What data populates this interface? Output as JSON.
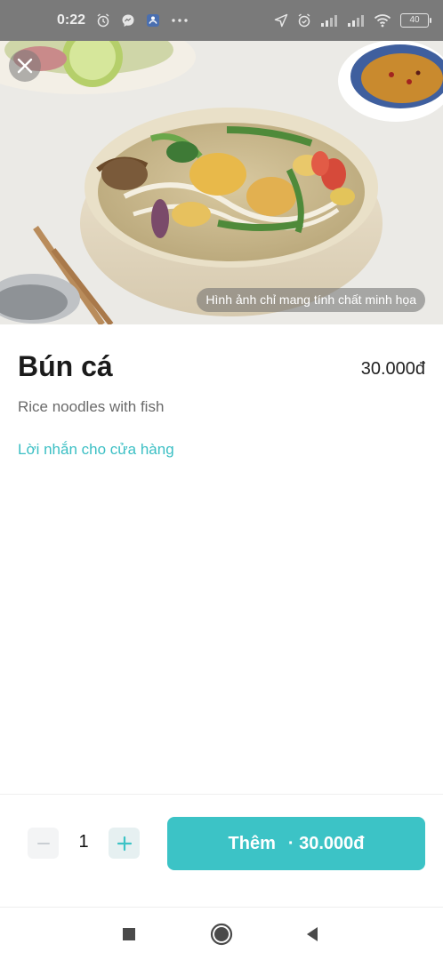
{
  "status_bar": {
    "time": "0:22",
    "battery": "40"
  },
  "hero": {
    "illustration_note": "Hình ảnh chỉ mang tính chất minh họa"
  },
  "product": {
    "name": "Bún cá",
    "price": "30.000đ",
    "description": "Rice noodles with fish",
    "store_note_link": "Lời nhắn cho cửa hàng"
  },
  "cart": {
    "quantity": "1",
    "add_label": "Thêm",
    "add_price": "· 30.000đ"
  },
  "colors": {
    "accent": "#3cc3c6",
    "link": "#3bbfc4",
    "status_bar": "#7a7a7a"
  }
}
